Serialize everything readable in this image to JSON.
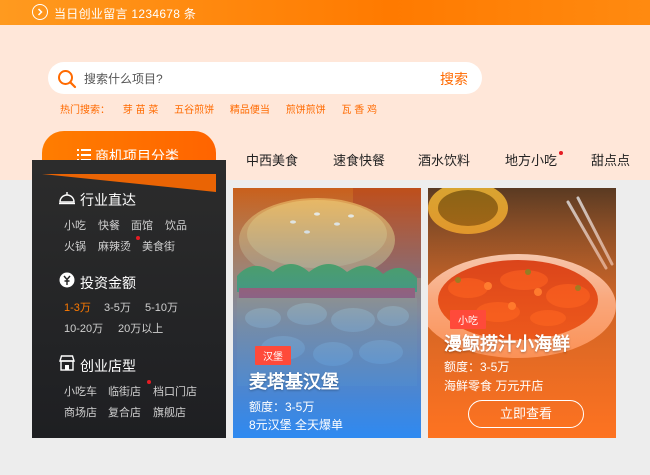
{
  "topbar": {
    "text": "当日创业留言 1234678 条"
  },
  "search": {
    "placeholder": "搜索什么项目?",
    "button": "搜索"
  },
  "hot": {
    "label": "热门搜索：",
    "items": [
      "芽 苗 菜",
      "五谷煎饼",
      "精品便当",
      "煎饼煎饼",
      "瓦 香 鸡"
    ]
  },
  "category_tab": {
    "label": "商机项目分类"
  },
  "nav": [
    "中西美食",
    "速食快餐",
    "酒水饮料",
    "地方小吃",
    "甜点点"
  ],
  "sidebar": {
    "sections": [
      {
        "title": "行业直达",
        "links": [
          "小吃",
          "快餐",
          "面馆",
          "饮品",
          "火锅",
          "麻辣烫",
          "美食街"
        ]
      },
      {
        "title": "投资金额",
        "links": [
          "1-3万",
          "3-5万",
          "5-10万",
          "10-20万",
          "20万以上"
        ]
      },
      {
        "title": "创业店型",
        "links": [
          "小吃车",
          "临街店",
          "档口门店",
          "商场店",
          "复合店",
          "旗舰店"
        ]
      }
    ]
  },
  "cards": [
    {
      "tag": "汉堡",
      "title": "麦塔基汉堡",
      "line1": "额度：3-5万",
      "line2": "8元汉堡 全天爆单"
    },
    {
      "tag": "小吃",
      "title": "漫鲸捞汁小海鲜",
      "line1": "额度：3-5万",
      "line2": "海鲜零食 万元开店",
      "cta": "立即查看"
    }
  ],
  "colors": {
    "accent": "#ff6a00",
    "hero_bg": "#ffe7d9",
    "sidebar_bg": "#222326",
    "tag_red": "#ff4a3a"
  }
}
